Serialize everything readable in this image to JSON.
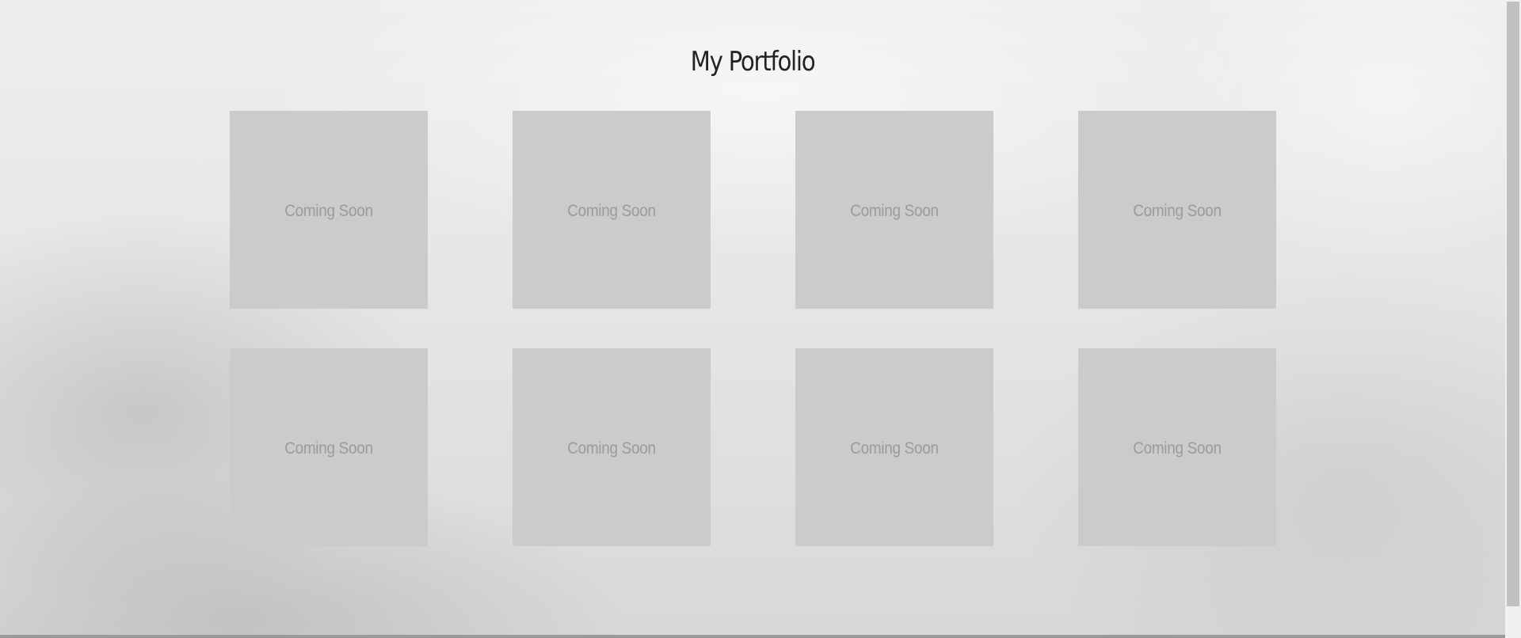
{
  "page": {
    "title": "My Portfolio"
  },
  "portfolio": {
    "items": [
      {
        "label": "Coming Soon"
      },
      {
        "label": "Coming Soon"
      },
      {
        "label": "Coming Soon"
      },
      {
        "label": "Coming Soon"
      },
      {
        "label": "Coming Soon"
      },
      {
        "label": "Coming Soon"
      },
      {
        "label": "Coming Soon"
      },
      {
        "label": "Coming Soon"
      }
    ]
  },
  "colors": {
    "tile": "#cbcbcb",
    "tile_text": "#9b9b9b",
    "title_text": "#222222"
  }
}
